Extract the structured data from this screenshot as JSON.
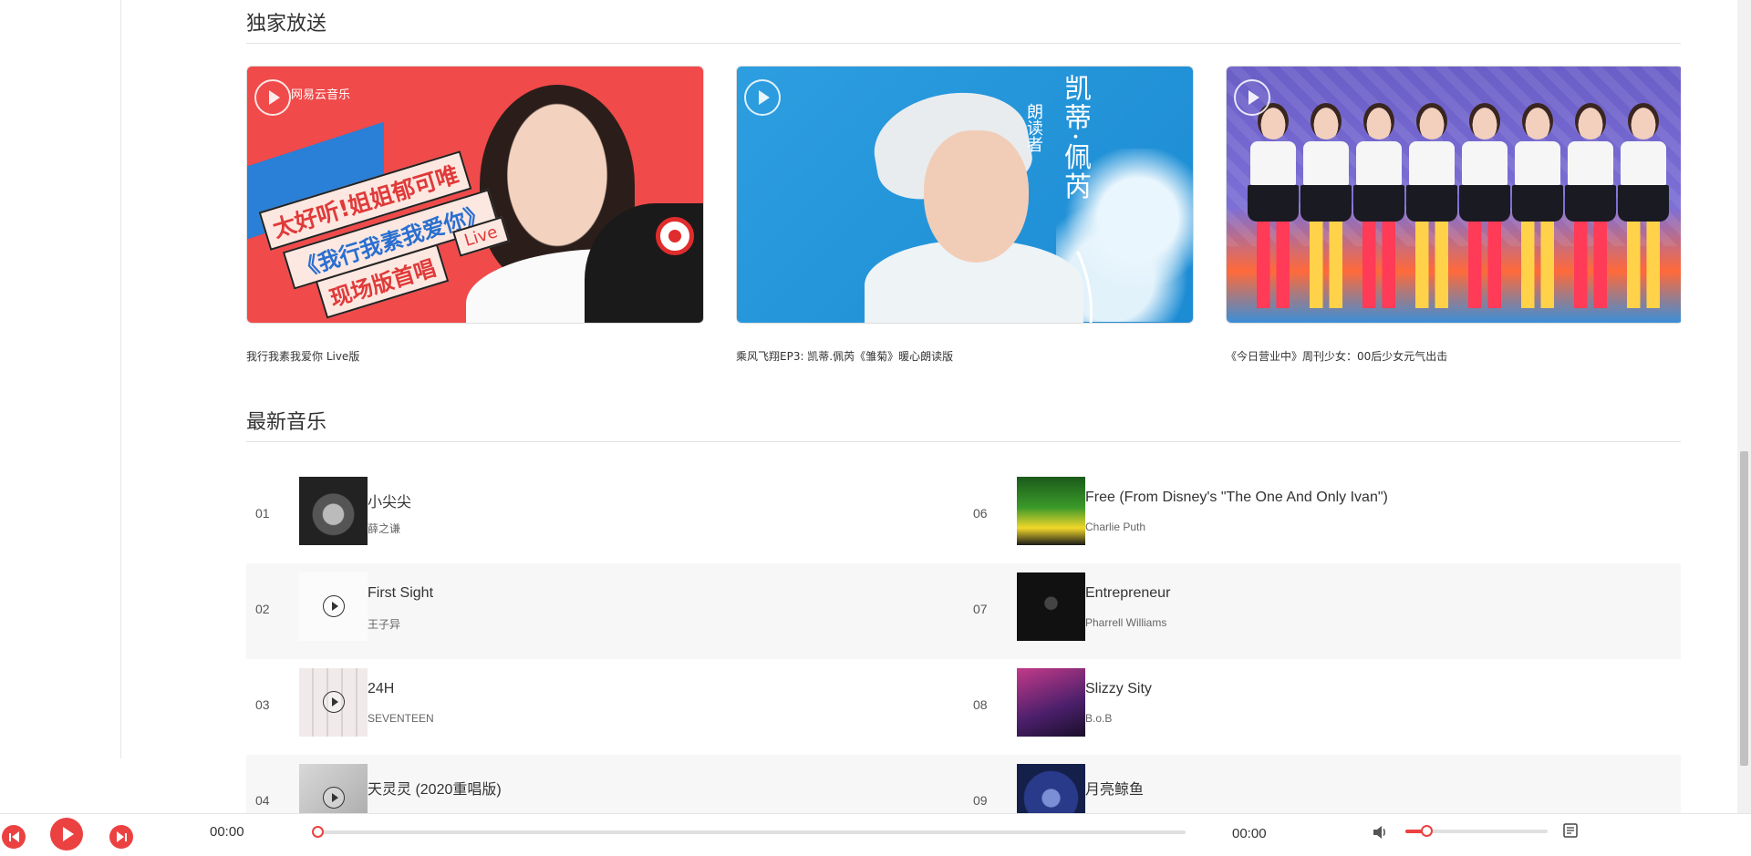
{
  "sections": {
    "exclusive_title": "独家放送",
    "new_music_title": "最新音乐"
  },
  "exclusive": [
    {
      "caption": "我行我素我爱你 Live版",
      "art_logo": "网易云音乐",
      "art_banner_1": "太好听!姐姐郁可唯",
      "art_banner_2": "《我行我素我爱你》",
      "art_banner_3": "现场版首唱",
      "art_banner_live": "Live"
    },
    {
      "caption": "乘风飞翔EP3: 凯蒂.佩芮《雏菊》暖心朗读版",
      "art_title": "凯蒂·佩芮",
      "art_subtitle": "朗读者"
    },
    {
      "caption": "《今日营业中》周刊少女：00后少女元气出击"
    }
  ],
  "songs": [
    {
      "num": "01",
      "name": "小尖尖",
      "artist": "薛之谦",
      "cover_color": "#3a3a3a"
    },
    {
      "num": "02",
      "name": "First Sight",
      "artist": "王子异",
      "cover_color": "#f4f4f4"
    },
    {
      "num": "03",
      "name": "24H",
      "artist": "SEVENTEEN",
      "cover_color": "#e9e4e4"
    },
    {
      "num": "04",
      "name": "天灵灵 (2020重唱版)",
      "artist": "",
      "cover_color": "#cfcfcf"
    },
    {
      "num": "06",
      "name": "Free (From Disney's \"The One And Only Ivan\")",
      "artist": "Charlie Puth",
      "cover_color": "#2f8a2c"
    },
    {
      "num": "07",
      "name": "Entrepreneur",
      "artist": "Pharrell Williams",
      "cover_color": "#111111"
    },
    {
      "num": "08",
      "name": "Slizzy Sity",
      "artist": "B.o.B",
      "cover_color": "#5a2a7a"
    },
    {
      "num": "09",
      "name": "月亮鲸鱼",
      "artist": "",
      "cover_color": "#1d2b6a"
    }
  ],
  "player": {
    "current_time": "00:00",
    "total_time": "00:00",
    "progress": 0,
    "volume": 0.15
  },
  "colors": {
    "accent": "#ec4141"
  },
  "icons": {
    "prev": "skip-previous-icon",
    "play": "play-icon",
    "next": "skip-next-icon",
    "volume": "volume-icon",
    "playlist": "playlist-icon"
  }
}
